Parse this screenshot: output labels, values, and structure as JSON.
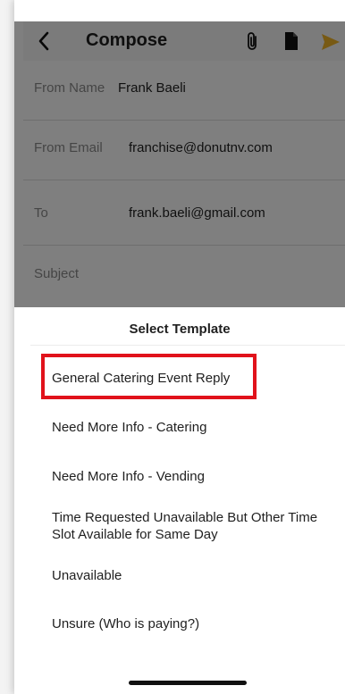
{
  "header": {
    "title": "Compose",
    "icons": [
      "back-icon",
      "paperclip-icon",
      "document-icon",
      "send-icon"
    ],
    "send_color": "#f0b429"
  },
  "fields": [
    {
      "label": "From Name",
      "value": "Frank Baeli"
    },
    {
      "label": "From Email",
      "value": "franchise@donutnv.com"
    },
    {
      "label": "To",
      "value": "frank.baeli@gmail.com"
    },
    {
      "label": "Subject",
      "value": ""
    }
  ],
  "sheet": {
    "title": "Select Template",
    "templates": [
      "General Catering Event Reply",
      "Need More Info - Catering",
      "Need More Info - Vending",
      "Time Requested Unavailable But Other Time Slot Available for Same Day",
      "Unavailable",
      "Unsure (Who is paying?)"
    ],
    "highlight_color": "#e1121b"
  }
}
